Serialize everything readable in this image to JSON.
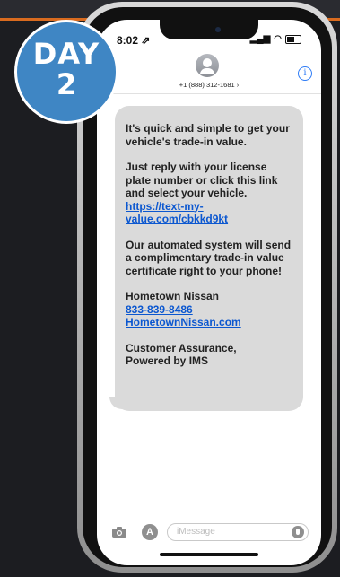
{
  "badge": {
    "day_label": "DAY",
    "day_number": "2"
  },
  "status": {
    "time": "8:02 ⇗"
  },
  "contact": {
    "number": "+1 (888) 312-1681 ›"
  },
  "icons": {
    "info": "info-icon",
    "camera": "camera-icon",
    "apps": "app-store-icon",
    "mic": "microphone-icon"
  },
  "message": {
    "p1": [
      "It's quick and simple to get your",
      "vehicle's trade-in value."
    ],
    "p2": [
      "Just reply with your license",
      "plate number or click this link",
      "and select your vehicle."
    ],
    "p2_link": "https://text-my-value.com/cbkkd9kt",
    "p3": [
      "Our automated system will send",
      "a complimentary trade-in value",
      "certificate right to your phone!"
    ],
    "p4_name": "Hometown Nissan",
    "p4_phone": "833-839-8486",
    "p4_site": "HometownNissan.com",
    "p5": [
      "Customer Assurance,",
      "Powered by IMS"
    ]
  },
  "input": {
    "placeholder": "iMessage"
  },
  "colors": {
    "badge": "#3f86c4",
    "link": "#0b57d0",
    "bubble": "#dadada",
    "accent": "#d96b1f"
  }
}
